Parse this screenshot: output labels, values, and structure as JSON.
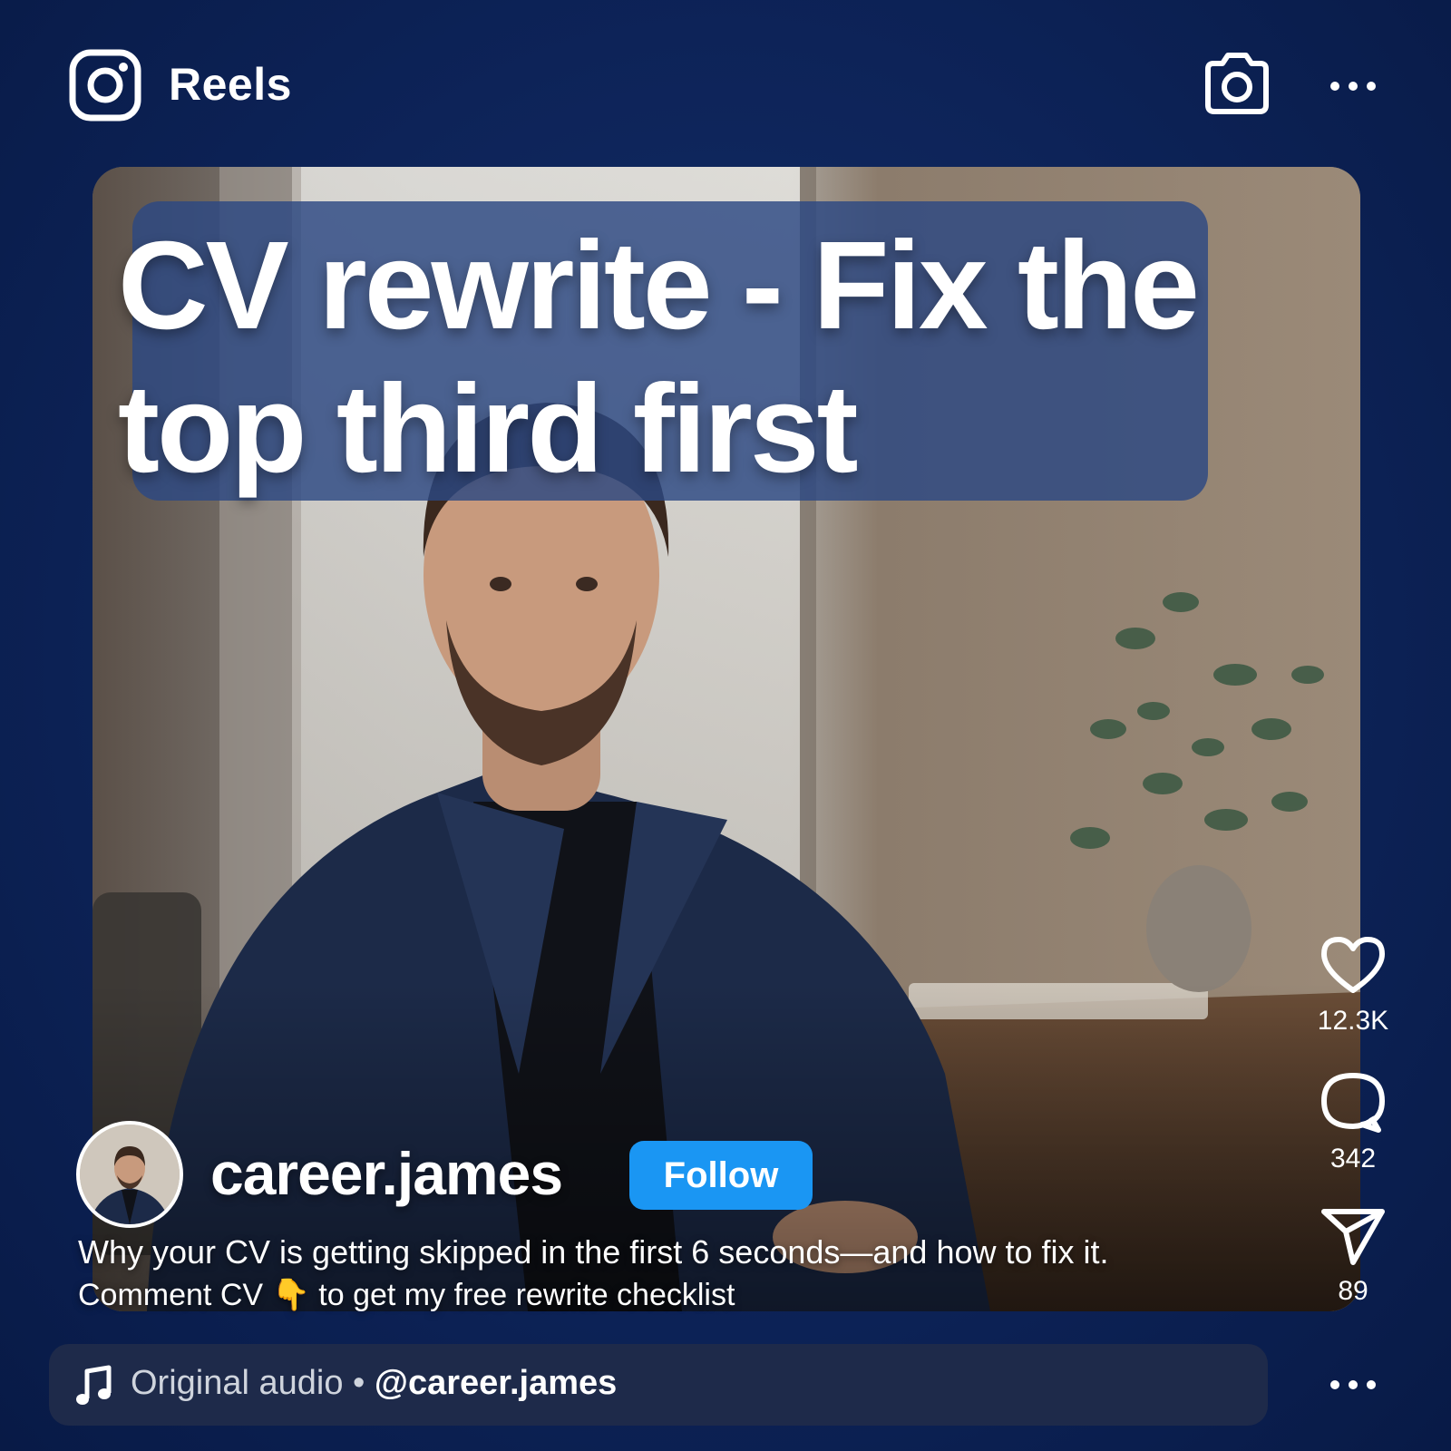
{
  "topbar": {
    "title": "Reels",
    "logo_icon": "instagram-logo-icon",
    "camera_icon": "camera-icon",
    "more_icon": "more-horizontal-icon"
  },
  "video": {
    "headline": "CV rewrite - Fix the\ntop third first"
  },
  "author": {
    "username": "career.james",
    "follow_label": "Follow"
  },
  "caption": {
    "line1": "Why your CV is getting skipped in the first 6 seconds—and how to fix it.",
    "line2": "Comment CV 👇 to get my free rewrite checklist"
  },
  "actions": {
    "likes": "12.3K",
    "comments": "342",
    "shares": "89"
  },
  "audio": {
    "label": "Original audio",
    "separator": " • ",
    "handle": "@career.james"
  },
  "colors": {
    "background": "#0d2358",
    "follow": "#1a96f3",
    "headline_box": "#2c4882"
  }
}
